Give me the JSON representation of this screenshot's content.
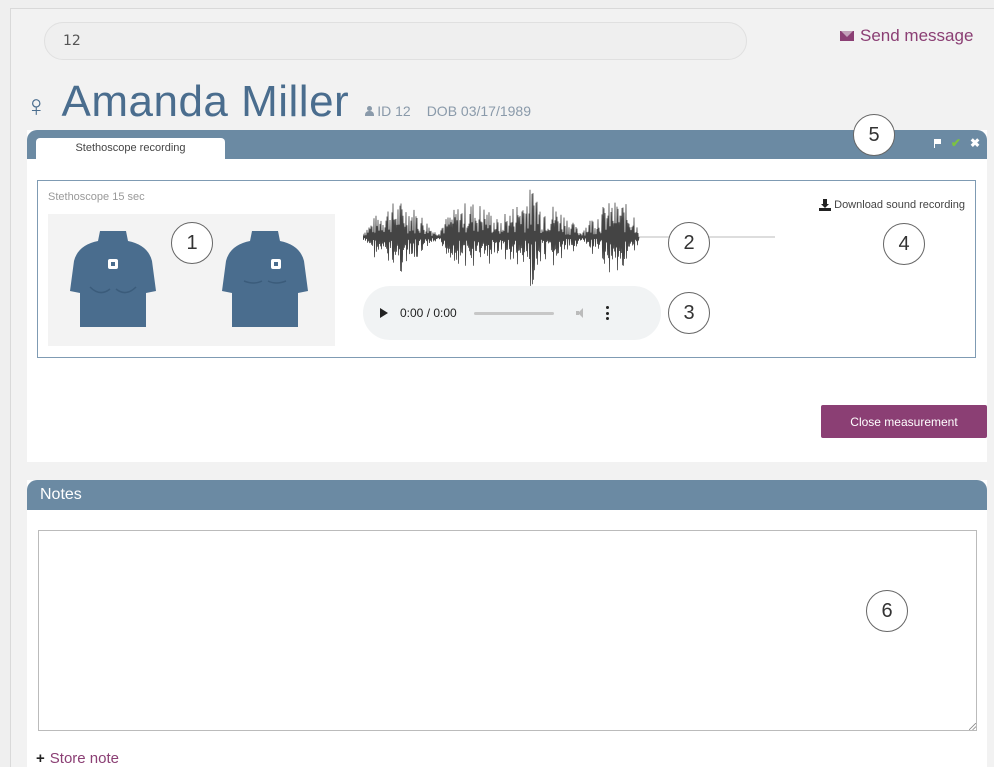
{
  "search": {
    "value": "12"
  },
  "header": {
    "send_message": "Send message"
  },
  "patient": {
    "gender_symbol": "♀",
    "name": "Amanda Miller",
    "id": "ID 12",
    "dob": "DOB 03/17/1989"
  },
  "measurement": {
    "tab_label": "Stethoscope recording",
    "recording_label": "Stethoscope 15 sec",
    "download_label": "Download sound recording",
    "audio_time": "0:00 / 0:00",
    "close_button": "Close measurement"
  },
  "notes": {
    "title": "Notes",
    "text": "",
    "store_label": "Store note"
  },
  "callouts": [
    "1",
    "2",
    "3",
    "4",
    "5",
    "6"
  ],
  "colors": {
    "primary_blue": "#6b8aa3",
    "accent_purple": "#8b3f74",
    "torso": "#4a6d8e",
    "check_green": "#7cc242"
  }
}
